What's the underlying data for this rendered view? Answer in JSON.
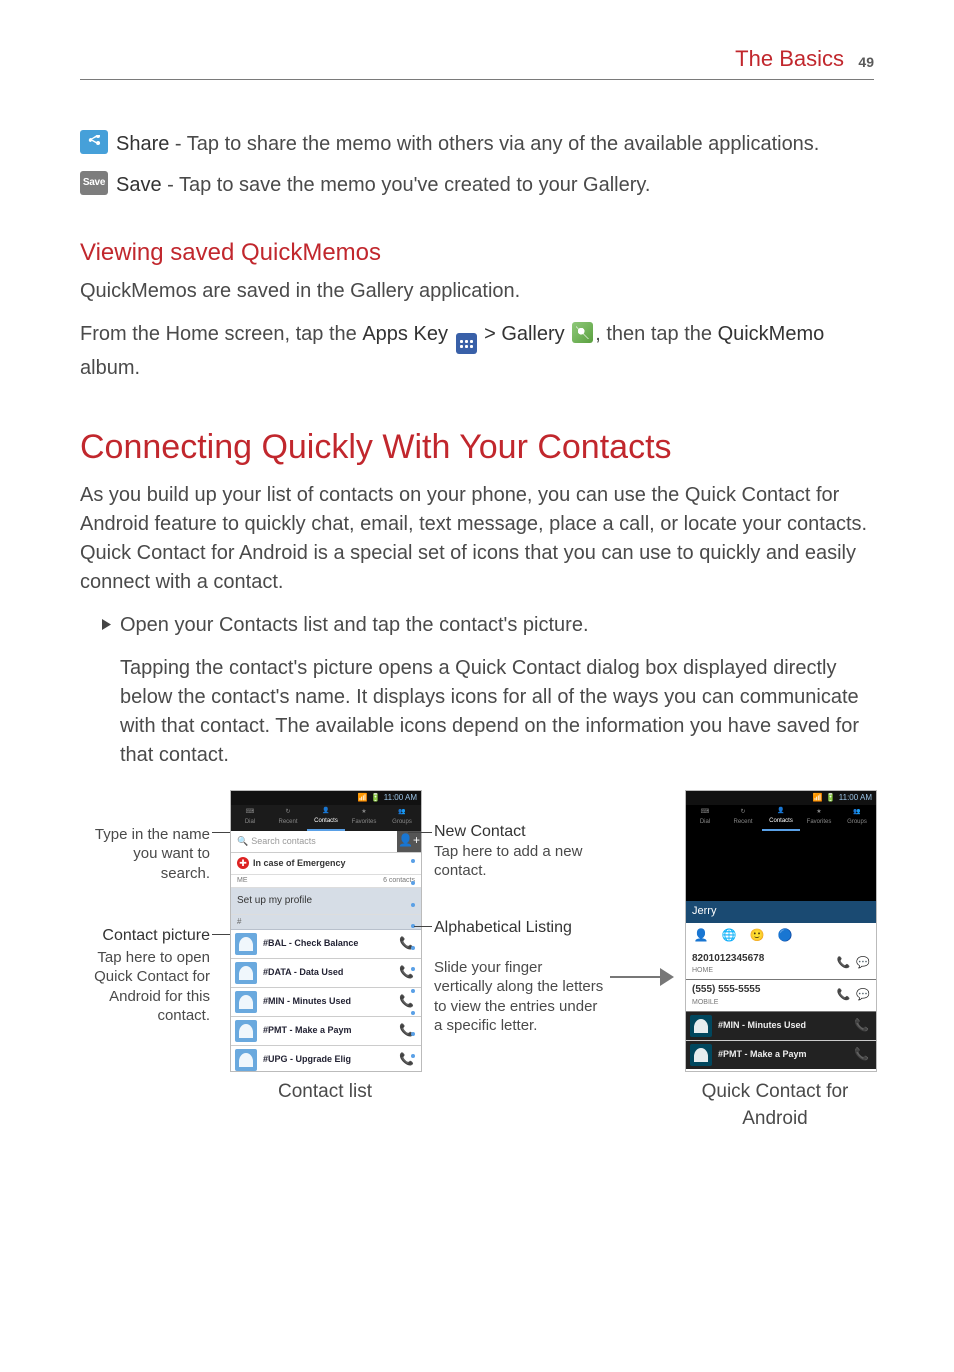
{
  "header": {
    "section": "The Basics",
    "page": "49"
  },
  "share": {
    "label": "Share",
    "text": " - Tap to share the memo with others via any of the available applications."
  },
  "save": {
    "iconText": "Save",
    "label": "Save",
    "text": " - Tap to save the memo you've created to your Gallery."
  },
  "viewing": {
    "heading": "Viewing saved QuickMemos",
    "p1": "QuickMemos are saved in the Gallery application.",
    "p2a": "From the Home screen, tap the ",
    "appsKey": "Apps Key",
    "gt": " > ",
    "gallery": "Gallery",
    "p2b": ", then tap the ",
    "quickmemo": "QuickMemo",
    "p2c": " album."
  },
  "connect": {
    "heading": "Connecting Quickly With Your Contacts",
    "intro": "As you build up your list of contacts on your phone, you can use the Quick Contact for Android feature to quickly chat, email, text message, place a call, or locate your contacts. Quick Contact for Android is a special set of icons that you can use to quickly and easily connect with a contact.",
    "bullet": "Open your Contacts list and tap the contact's picture.",
    "after": "Tapping the contact's picture opens a Quick Contact dialog box displayed directly below the contact's name. It displays icons for all of the ways you can communicate with that contact. The available icons depend on the information you have saved for that contact."
  },
  "figure": {
    "typeLabel": "Type in the name you want to search.",
    "contactPic": "Contact picture",
    "contactPicSub": "Tap here to open Quick Contact for Android for this contact.",
    "newContact": "New Contact",
    "newContactSub": "Tap here to add a new contact.",
    "alphaTitle": "Alphabetical Listing",
    "alphaSub": "Slide your finger vertically along the letters to view the entries under a specific letter.",
    "caption1": "Contact list",
    "caption2": "Quick Contact for Android",
    "statusTime": "11:00 AM",
    "tabs": [
      "Dial",
      "Recent",
      "Contacts",
      "Favorites",
      "Groups"
    ],
    "searchPlaceholder": "Search contacts",
    "ice": "In case of Emergency",
    "meLabel": "ME",
    "meCount": "6 contacts",
    "setup": "Set up my profile",
    "hash": "#",
    "rows": [
      "#BAL - Check Balance",
      "#DATA - Data Used",
      "#MIN - Minutes Used",
      "#PMT - Make a Paym",
      "#UPG - Upgrade Elig"
    ],
    "qcName": "Jerry",
    "qcNum": "8201012345678",
    "qcNumSub": "HOME",
    "qcPhone": "(555) 555-5555",
    "qcPhoneSub": "MOBILE",
    "qcRow3": "#MIN - Minutes Used",
    "qcRow4": "#PMT - Make a Paym"
  }
}
